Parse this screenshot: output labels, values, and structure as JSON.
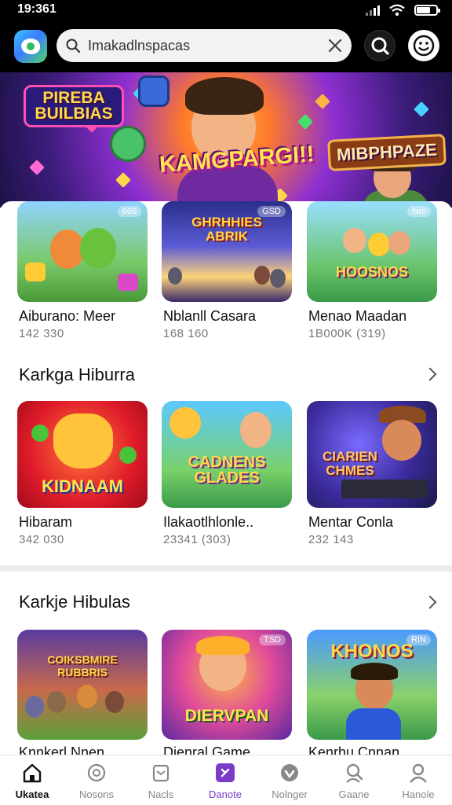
{
  "status_bar": {
    "time": "19:361",
    "battery_level": 0.7
  },
  "header": {
    "search_text": "Imakadlnspacas"
  },
  "hero": {
    "title_left": "PIREBA BUILBIAS",
    "title_center": "KAMGPARGI!!",
    "title_right": "MIBPHPAZE"
  },
  "rows": [
    {
      "title": "",
      "items": [
        {
          "name": "Aiburano: Meer",
          "meta": "142 330",
          "badge": "660",
          "art_text": ""
        },
        {
          "name": "Nblanll Casara",
          "meta": "168 160",
          "badge": "GSD",
          "art_text": "GHRHHIES ABRIK"
        },
        {
          "name": "Menao Maadan",
          "meta": "1B000K (319)",
          "badge": "him",
          "art_text": "HOOSNOS"
        }
      ]
    },
    {
      "title": "Karkga Hiburra",
      "items": [
        {
          "name": "Hibaram",
          "meta": "342 030",
          "badge": "",
          "art_text": "KIDNAAM"
        },
        {
          "name": "Ilakaotlhlonle..",
          "meta": "23341 (303)",
          "badge": "",
          "art_text": "CADNENS GLADES"
        },
        {
          "name": "Mentar Conla",
          "meta": "232 143",
          "badge": "",
          "art_text": "CIARIEN CHMES"
        }
      ]
    },
    {
      "title": "Karkje Hibulas",
      "items": [
        {
          "name": "Knnkerl Nnen",
          "meta": "",
          "badge": "",
          "art_text": "COIKSBMIRE RUBBRIS"
        },
        {
          "name": "Dienral Game",
          "meta": "",
          "badge": "TSD",
          "art_text": "DIERVPAN"
        },
        {
          "name": "Kenrhu Cnnan",
          "meta": "",
          "badge": "RIN",
          "art_text": "KHONOS"
        }
      ]
    }
  ],
  "bottom_nav": [
    {
      "label": "Ukatea",
      "icon": "home-icon",
      "state": "active"
    },
    {
      "label": "Nosons",
      "icon": "discover-icon",
      "state": "normal"
    },
    {
      "label": "Nacls",
      "icon": "inbox-icon",
      "state": "normal"
    },
    {
      "label": "Danote",
      "icon": "gamepad-icon",
      "state": "featured"
    },
    {
      "label": "Nolnger",
      "icon": "heart-icon",
      "state": "normal"
    },
    {
      "label": "Gaane",
      "icon": "controller-icon",
      "state": "normal"
    },
    {
      "label": "Hanole",
      "icon": "profile-icon",
      "state": "normal"
    }
  ],
  "colors": {
    "featured_accent": "#7a3bc6",
    "header_bg": "#000000"
  }
}
